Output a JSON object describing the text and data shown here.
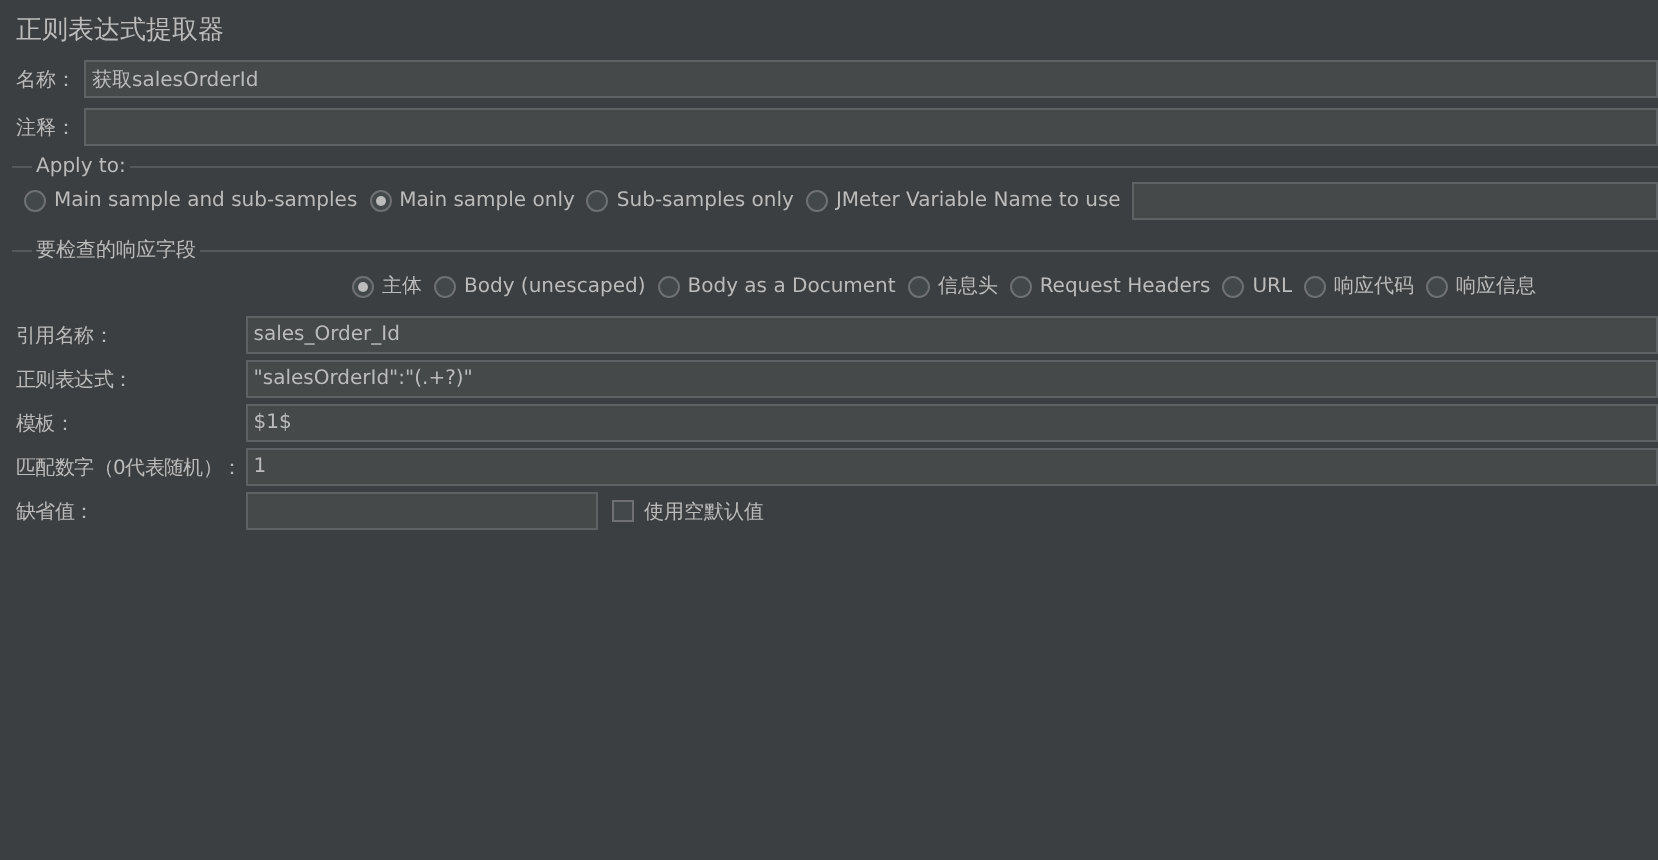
{
  "title": "正则表达式提取器",
  "name": {
    "label": "名称：",
    "value": "获取salesOrderId"
  },
  "comment": {
    "label": "注释："
  },
  "apply_to": {
    "legend": "Apply to:",
    "options": [
      {
        "label": "Main sample and sub-samples",
        "selected": false
      },
      {
        "label": "Main sample only",
        "selected": true
      },
      {
        "label": "Sub-samples only",
        "selected": false
      },
      {
        "label": "JMeter Variable Name to use",
        "selected": false
      }
    ]
  },
  "field_to_check": {
    "legend": "要检查的响应字段",
    "options": [
      {
        "label": "主体",
        "selected": true
      },
      {
        "label": "Body (unescaped)",
        "selected": false
      },
      {
        "label": "Body as a Document",
        "selected": false
      },
      {
        "label": "信息头",
        "selected": false
      },
      {
        "label": "Request Headers",
        "selected": false
      },
      {
        "label": "URL",
        "selected": false
      },
      {
        "label": "响应代码",
        "selected": false
      },
      {
        "label": "响应信息",
        "selected": false
      }
    ]
  },
  "fields": [
    {
      "label": "引用名称：",
      "value": "sales_Order_Id"
    },
    {
      "label": "正则表达式：",
      "value": "\"salesOrderId\":\"(.+?)\""
    },
    {
      "label": "模板：",
      "value": "$1$"
    },
    {
      "label": "匹配数字（0代表随机）：",
      "value": "1"
    }
  ],
  "default": {
    "label": "缺省值：",
    "checkbox": {
      "label": "使用空默认值",
      "checked": false
    }
  }
}
